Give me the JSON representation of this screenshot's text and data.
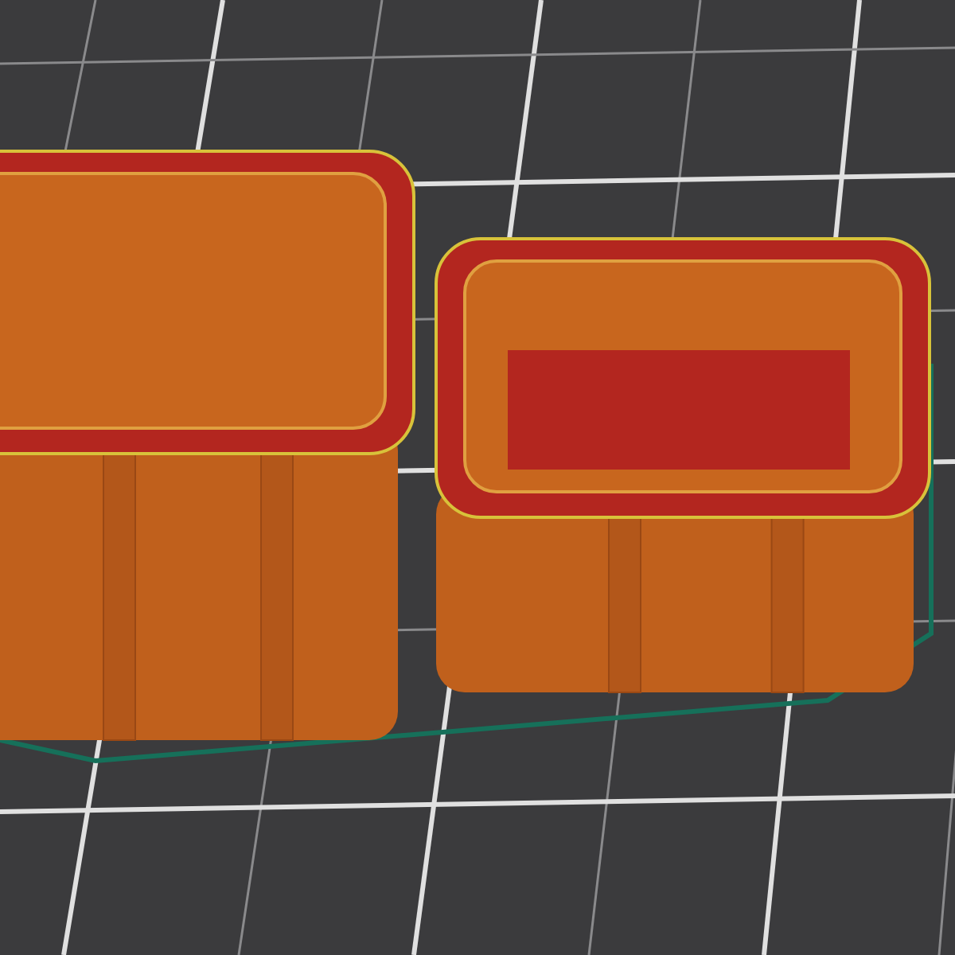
{
  "scene": {
    "build_plate_grid": true,
    "skirt_outline": true,
    "objects": [
      {
        "kind": "bin"
      },
      {
        "kind": "bin"
      }
    ]
  }
}
